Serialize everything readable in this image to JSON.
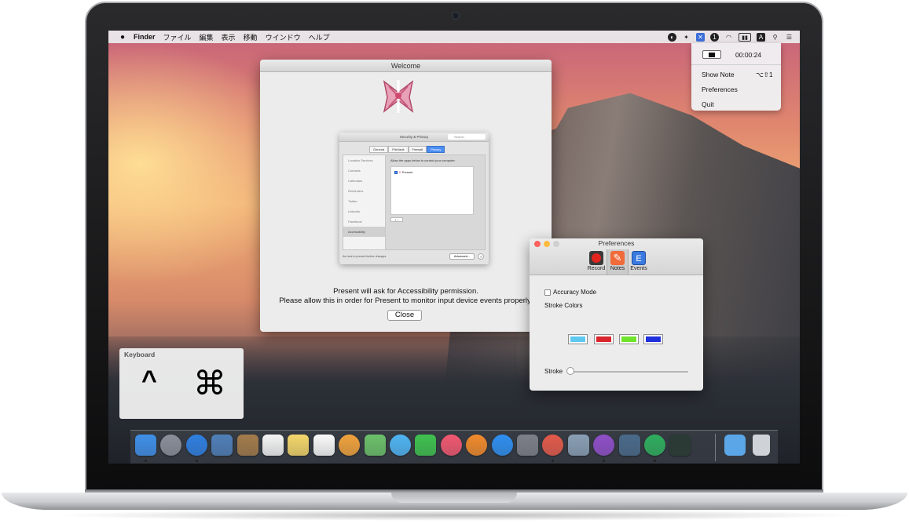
{
  "menubar": {
    "app": "Finder",
    "items": [
      "ファイル",
      "編集",
      "表示",
      "移動",
      "ウインドウ",
      "ヘルプ"
    ],
    "status_icons": [
      "night-owl-icon",
      "dropbox-icon",
      "present-icon",
      "1password-icon",
      "wifi-icon",
      "battery-icon",
      "input-source-icon",
      "spotlight-icon",
      "notification-center-icon"
    ],
    "input_source": "A"
  },
  "status_menu": {
    "timer": "00:00:24",
    "show_note": "Show Note",
    "show_note_shortcut": "⌥⇧1",
    "preferences": "Preferences",
    "quit": "Quit"
  },
  "welcome": {
    "title": "Welcome",
    "screenshot": {
      "title": "Security & Privacy",
      "search_placeholder": "Search",
      "tabs": [
        "General",
        "FileVault",
        "Firewall",
        "Privacy"
      ],
      "active_tab": "Privacy",
      "list": [
        "Location Services",
        "Contacts",
        "Calendars",
        "Reminders",
        "Twitter",
        "LinkedIn",
        "Facebook",
        "Accessibility"
      ],
      "selected": "Accessibility",
      "header": "Allow the apps below to control your computer.",
      "app_row": "Present",
      "footer": "the lock to prevent further changes.",
      "advanced": "Advanced...",
      "help": "?"
    },
    "message_line1": "Present will ask for Accessibility permission.",
    "message_line2": "Please allow this in order for Present to monitor input device events properly.",
    "close_label": "Close"
  },
  "preferences": {
    "title": "Preferences",
    "tabs": [
      "Record",
      "Notes",
      "Events"
    ],
    "selected_tab": "Notes",
    "accuracy_mode": "Accuracy Mode",
    "accuracy_checked": false,
    "stroke_colors_label": "Stroke Colors",
    "stroke_colors": [
      "#5fc8f0",
      "#d8262c",
      "#6fe32c",
      "#1f2fdb"
    ],
    "stroke_label": "Stroke",
    "stroke_value": 0
  },
  "keyboard": {
    "title": "Keyboard",
    "keys": [
      "^",
      "⌘"
    ]
  },
  "dock": {
    "apps": [
      {
        "name": "finder-icon",
        "color": "#3f8fe8",
        "running": true
      },
      {
        "name": "launchpad-icon",
        "color": "#8a8f99",
        "running": false
      },
      {
        "name": "safari-icon",
        "color": "#2f7fe0",
        "running": true
      },
      {
        "name": "preview-icon",
        "color": "#4f7fb8",
        "running": false
      },
      {
        "name": "contacts-icon",
        "color": "#a27b4b",
        "running": false
      },
      {
        "name": "calendar-icon",
        "color": "#f4f4f4",
        "running": false
      },
      {
        "name": "notes-icon",
        "color": "#f3d66a",
        "running": false
      },
      {
        "name": "reminders-icon",
        "color": "#fafafa",
        "running": false
      },
      {
        "name": "photos-icon",
        "color": "#f0a23c",
        "running": false
      },
      {
        "name": "maps-icon",
        "color": "#6cc16a",
        "running": false
      },
      {
        "name": "messages-icon",
        "color": "#4fb4f2",
        "running": false
      },
      {
        "name": "facetime-icon",
        "color": "#3fc14f",
        "running": false
      },
      {
        "name": "itunes-icon",
        "color": "#f05870",
        "running": false
      },
      {
        "name": "ibooks-icon",
        "color": "#f08a2c",
        "running": false
      },
      {
        "name": "app-store-icon",
        "color": "#2f8ff0",
        "running": false
      },
      {
        "name": "system-preferences-icon",
        "color": "#7d8088",
        "running": false
      },
      {
        "name": "present-app-icon",
        "color": "#e35a4b",
        "running": true
      },
      {
        "name": "image-capture-icon",
        "color": "#8a9fb4",
        "running": false
      },
      {
        "name": "omnifocus-icon",
        "color": "#8f4fc8",
        "running": true
      },
      {
        "name": "photo-app-icon",
        "color": "#4a6a8a",
        "running": false
      },
      {
        "name": "1password-icon",
        "color": "#2fae5e",
        "running": true
      },
      {
        "name": "activity-monitor-icon",
        "color": "#2a3a34",
        "running": false
      }
    ],
    "downloads_color": "#5aa6e6",
    "trash_color": "#cfd3d8"
  }
}
